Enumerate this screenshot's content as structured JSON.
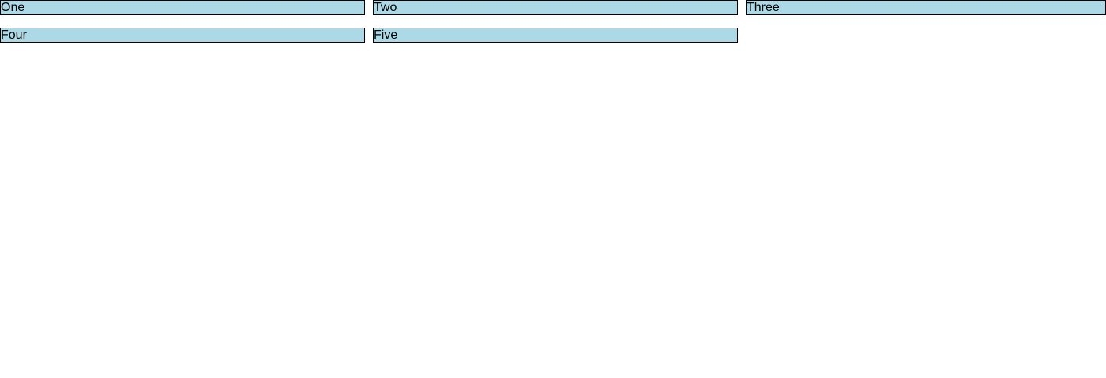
{
  "items": [
    {
      "label": "One"
    },
    {
      "label": "Two"
    },
    {
      "label": "Three"
    },
    {
      "label": "Four"
    },
    {
      "label": "Five"
    }
  ],
  "colors": {
    "item_background": "#add8e6",
    "item_border": "#000000",
    "page_background": "#ffffff"
  }
}
